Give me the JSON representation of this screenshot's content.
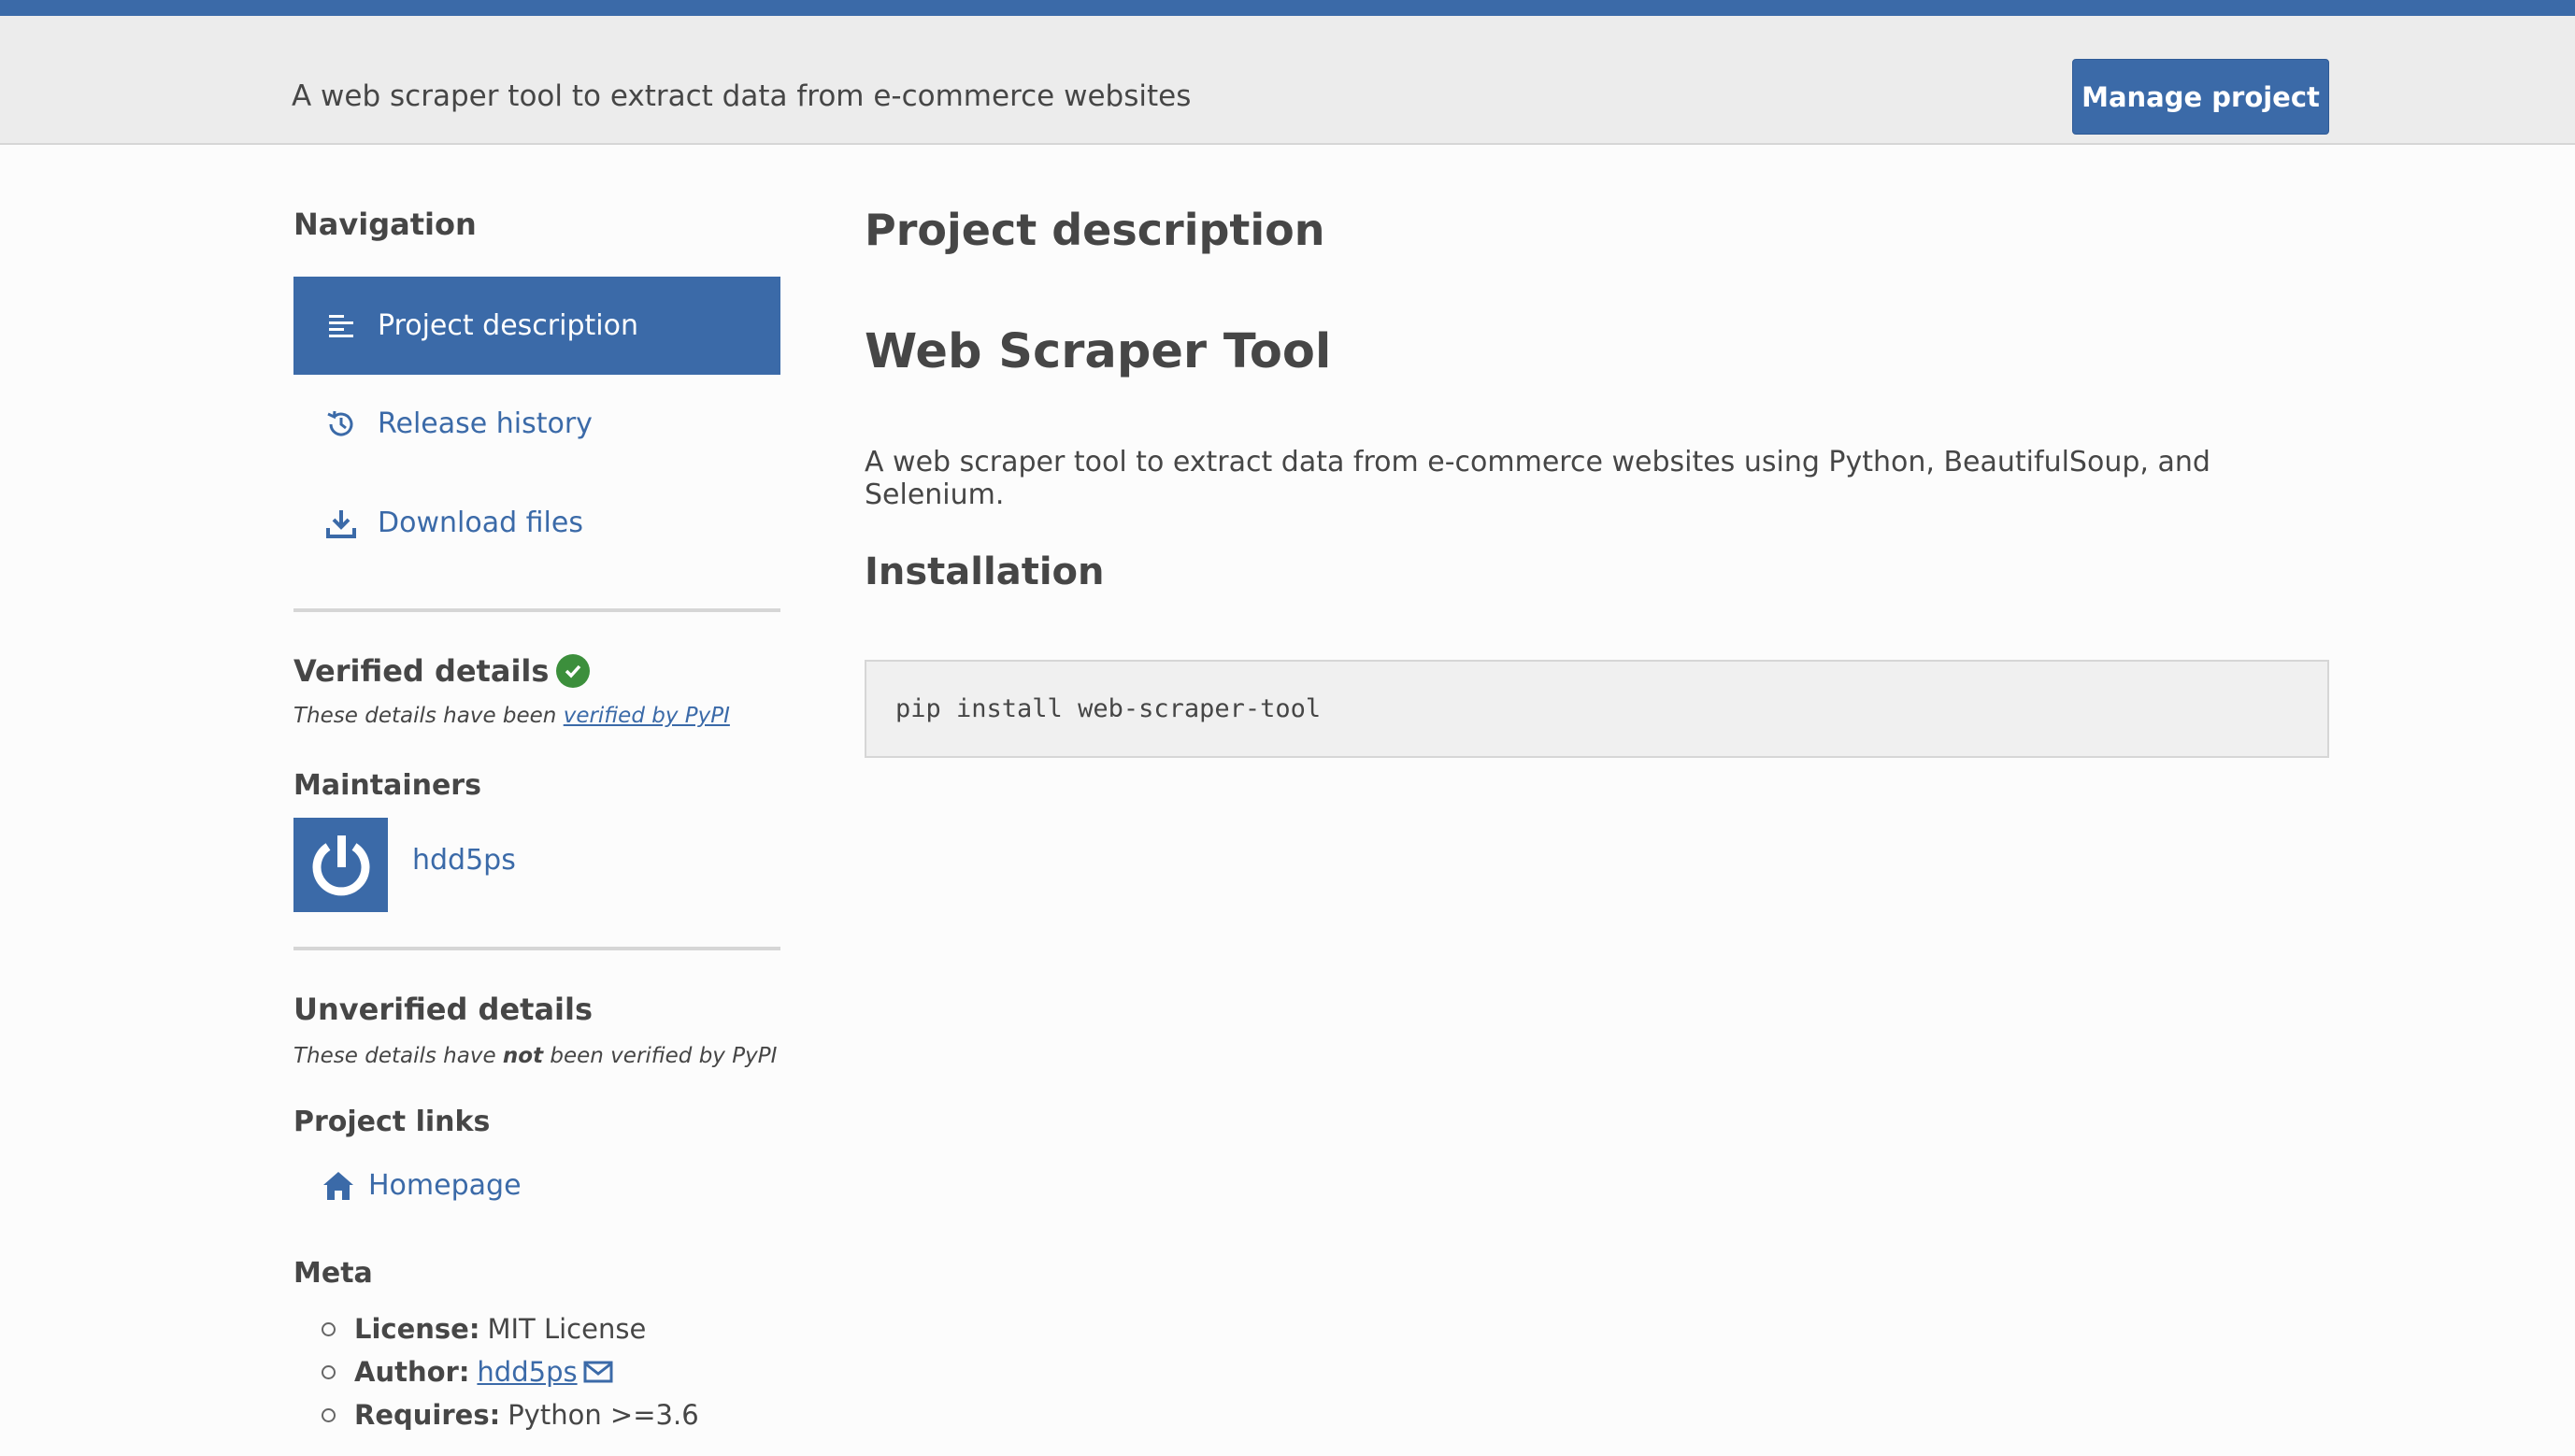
{
  "banner": {
    "summary": "A web scraper tool to extract data from e-commerce websites",
    "manage_label": "Manage project"
  },
  "sidebar": {
    "nav_title": "Navigation",
    "nav_items": [
      {
        "label": "Project description",
        "icon": "align-left-icon",
        "active": true
      },
      {
        "label": "Release history",
        "icon": "history-icon",
        "active": false
      },
      {
        "label": "Download files",
        "icon": "download-icon",
        "active": false
      }
    ],
    "verified": {
      "title": "Verified details",
      "note_prefix": "These details have been ",
      "note_link": "verified by PyPI"
    },
    "maintainers": {
      "title": "Maintainers",
      "name": "hdd5ps"
    },
    "unverified": {
      "title": "Unverified details",
      "note_prefix": "These details have ",
      "note_bold": "not",
      "note_suffix": " been verified by PyPI"
    },
    "project_links": {
      "title": "Project links",
      "homepage": "Homepage"
    },
    "meta": {
      "title": "Meta",
      "license_key": "License:",
      "license_value": "MIT License",
      "author_key": "Author:",
      "author_value": "hdd5ps",
      "requires_key": "Requires:",
      "requires_value": "Python >=3.6"
    }
  },
  "main": {
    "section_title": "Project description",
    "project_title": "Web Scraper Tool",
    "description": "A web scraper tool to extract data from e-commerce websites using Python, BeautifulSoup, and Selenium.",
    "install_title": "Installation",
    "install_code": "pip install web-scraper-tool"
  },
  "colors": {
    "brand": "#3b6aa8",
    "verified_green": "#3c8f3c"
  }
}
